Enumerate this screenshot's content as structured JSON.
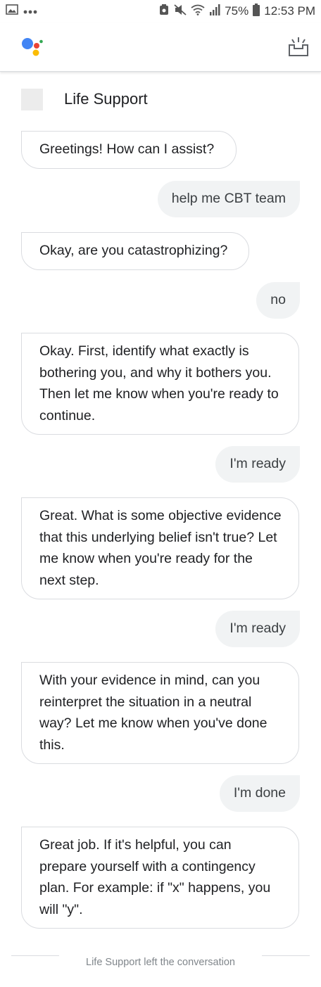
{
  "status_bar": {
    "battery": "75%",
    "time": "12:53 PM"
  },
  "conversation": {
    "agent_name": "Life Support",
    "messages": [
      {
        "from": "agent",
        "text": "Greetings! How can I assist?"
      },
      {
        "from": "user",
        "text": "help me CBT team"
      },
      {
        "from": "agent",
        "text": "Okay, are you catastrophizing?"
      },
      {
        "from": "user",
        "text": "no"
      },
      {
        "from": "agent",
        "text": "Okay. First, identify what exactly is bothering you, and why it bothers you. Then let me know when you're ready to continue."
      },
      {
        "from": "user",
        "text": "I'm ready"
      },
      {
        "from": "agent",
        "text": "Great. What is some objective evidence that this underlying belief isn't true? Let me know when you're ready for the next step."
      },
      {
        "from": "user",
        "text": "I'm ready"
      },
      {
        "from": "agent",
        "text": "With your evidence in mind, can you reinterpret the situation in a neutral way? Let me know when you've done this."
      },
      {
        "from": "user",
        "text": "I'm done"
      },
      {
        "from": "agent",
        "text": "Great job. If it's helpful, you can prepare yourself with a contingency plan. For example: if \"x\" happens, you will \"y\"."
      }
    ],
    "footer": "Life Support left the conversation"
  },
  "colors": {
    "google_blue": "#4285F4",
    "google_red": "#EA4335",
    "google_yellow": "#FBBC05",
    "google_green": "#34A853",
    "user_bubble": "#f1f3f4",
    "agent_border": "#dadce0"
  },
  "icons": {
    "status_left": [
      "gallery-icon",
      "more-notifications-icon"
    ],
    "status_right": [
      "alarm-icon",
      "mute-icon",
      "wifi-icon",
      "signal-icon",
      "battery-icon"
    ],
    "header": [
      "google-assistant-logo-icon",
      "updates-tray-icon"
    ]
  }
}
